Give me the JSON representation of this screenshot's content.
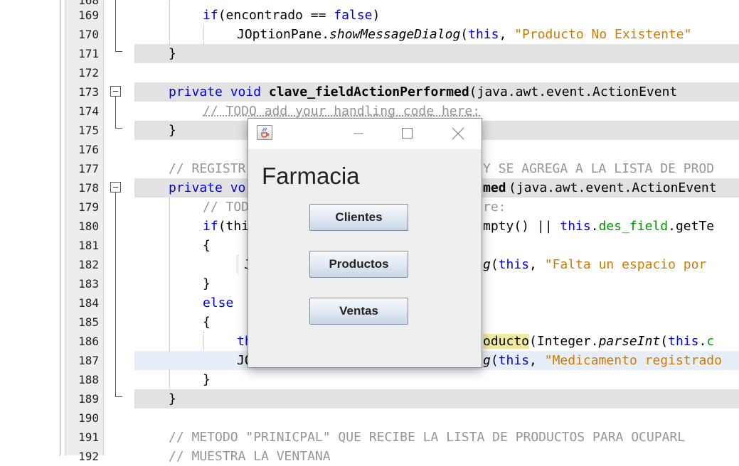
{
  "editor": {
    "lines": [
      {
        "no": "168"
      },
      {
        "no": "169",
        "kw": "if",
        "t1": "(encontrado == ",
        "kw2": "false",
        "t2": ")"
      },
      {
        "no": "170",
        "pre": "JOptionPane.",
        "method": "showMessageDialog",
        "mid": "(",
        "kw": "this",
        "sep": ", ",
        "str": "\"Producto No Existente\""
      },
      {
        "no": "171",
        "text": "}"
      },
      {
        "no": "172"
      },
      {
        "no": "173",
        "kw": "private void ",
        "name": "clave_fieldActionPerformed",
        "rest": "(java.awt.event.ActionEvent"
      },
      {
        "no": "174",
        "comment": "// TODO add your handling code here:"
      },
      {
        "no": "175",
        "text": "}"
      },
      {
        "no": "176"
      },
      {
        "no": "177",
        "comment": "// REGISTR",
        "comment2": "Y SE AGREGA A LA LISTA DE PROD"
      },
      {
        "no": "178",
        "kw": "private vo",
        "name": "med",
        "rest": "(java.awt.event.ActionEvent"
      },
      {
        "no": "179",
        "comment": "// TOD",
        "comment2": "re:"
      },
      {
        "no": "180",
        "kw": "if",
        "t1": "(thi",
        "t2": "mpty() || ",
        "kw2": "this",
        "t3": ".",
        "fld": "des_field",
        "t4": ".getTe"
      },
      {
        "no": "181",
        "text": "{"
      },
      {
        "no": "182",
        "t1": "J",
        "method": "g",
        "mid": "(",
        "kw": "this",
        "sep": ", ",
        "str": "\"Falta un espacio por"
      },
      {
        "no": "183",
        "text": "}"
      },
      {
        "no": "184",
        "kw": "else"
      },
      {
        "no": "185",
        "text": "{"
      },
      {
        "no": "186",
        "t1": "th",
        "hl": "oducto",
        "t2": "(Integer.",
        "method": "parseInt",
        "t3": "(",
        "kw": "this",
        "t4": ".",
        "fld": "c"
      },
      {
        "no": "187",
        "t1": "JO",
        "method": "g",
        "mid": "(",
        "kw": "this",
        "sep": ", ",
        "str": "\"Medicamento registrado"
      },
      {
        "no": "188",
        "text": "}"
      },
      {
        "no": "189",
        "text": "}"
      },
      {
        "no": "190"
      },
      {
        "no": "191",
        "comment": "// METODO \"PRINICPAL\" QUE RECIBE LA LISTA DE PRODUCTOS PARA OCUPARL"
      },
      {
        "no": "192",
        "comment": "// MUESTRA LA VENTANA"
      }
    ]
  },
  "dialog": {
    "title": "Farmacia",
    "buttons": {
      "clientes": "Clientes",
      "productos": "Productos",
      "ventas": "Ventas"
    }
  }
}
